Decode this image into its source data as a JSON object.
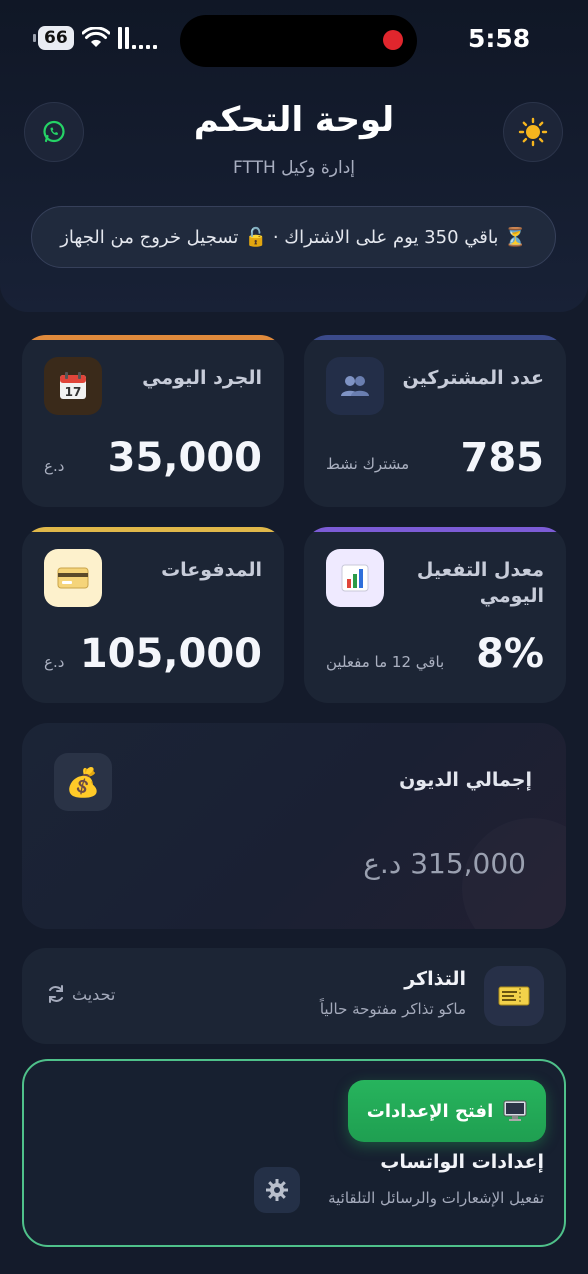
{
  "status_bar": {
    "battery": "66",
    "time": "5:58"
  },
  "header": {
    "title": "لوحة التحكم",
    "subtitle": "إدارة وكيل FTTH",
    "theme_icon": "sun-icon",
    "whatsapp_icon": "whatsapp-icon"
  },
  "notice": {
    "text": "باقي 350 يوم على الاشتراك · ",
    "lock_icon": "lock-icon",
    "logout_text": "تسجيل خروج من الجهاز",
    "hourglass_icon": "hourglass-icon"
  },
  "stats": {
    "subscribers": {
      "title": "عدد المشتركين",
      "value": "785",
      "unit": "مشترك نشط",
      "accent": "#3b4a8a"
    },
    "daily_inventory": {
      "title": "الجرد اليومي",
      "value": "35,000",
      "unit": "د.ع",
      "accent": "#e08a3c"
    },
    "activation_rate": {
      "title": "معدل التفعيل اليومي",
      "value": "8%",
      "unit": "باقي 12 ما مفعلين",
      "accent": "#7c5cd6"
    },
    "payments": {
      "title": "المدفوعات",
      "value": "105,000",
      "unit": "د.ع",
      "accent": "#e0b84a"
    }
  },
  "debt": {
    "title": "إجمالي الديون",
    "value": "315,000 د.ع"
  },
  "tickets": {
    "title": "التذاكر",
    "subtitle": "ماكو تذاكر مفتوحة حالياً",
    "refresh_label": "تحديث"
  },
  "whatsapp_settings": {
    "button_label": "افتح الإعدادات",
    "title": "إعدادات الواتساب",
    "subtitle": "تفعيل الإشعارات والرسائل التلقائية"
  }
}
